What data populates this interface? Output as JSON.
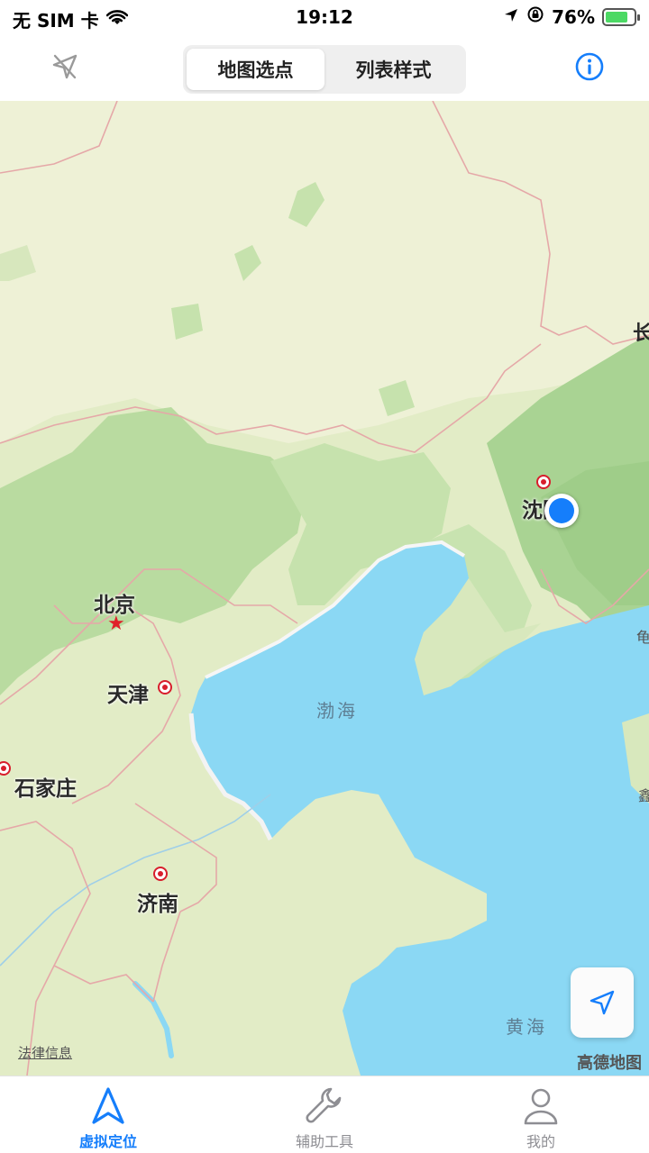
{
  "status_bar": {
    "carrier": "无 SIM 卡",
    "time": "19:12",
    "battery": "76%"
  },
  "nav": {
    "segments": [
      "地图选点",
      "列表样式"
    ],
    "active_segment": 0
  },
  "map": {
    "cities": {
      "beijing": "北京",
      "tianjin": "天津",
      "shijiazhuang": "石家庄",
      "jinan": "济南",
      "shenyang": "沈阳"
    },
    "seas": {
      "bohai": "渤海",
      "huanghai": "黄海"
    },
    "edge_labels": {
      "changchun": "长",
      "right_mid": "龟",
      "right_low": "鑫"
    },
    "legal_link": "法律信息",
    "brand": "高德地图"
  },
  "tabs": [
    {
      "label": "虚拟定位",
      "icon": "navigation-a-icon"
    },
    {
      "label": "辅助工具",
      "icon": "wrench-icon"
    },
    {
      "label": "我的",
      "icon": "person-icon"
    }
  ],
  "colors": {
    "accent": "#157efb",
    "land": "#eef1d6",
    "forest": "#b9dba0",
    "water": "#8bd8f4",
    "border": "#e5a8a8"
  }
}
